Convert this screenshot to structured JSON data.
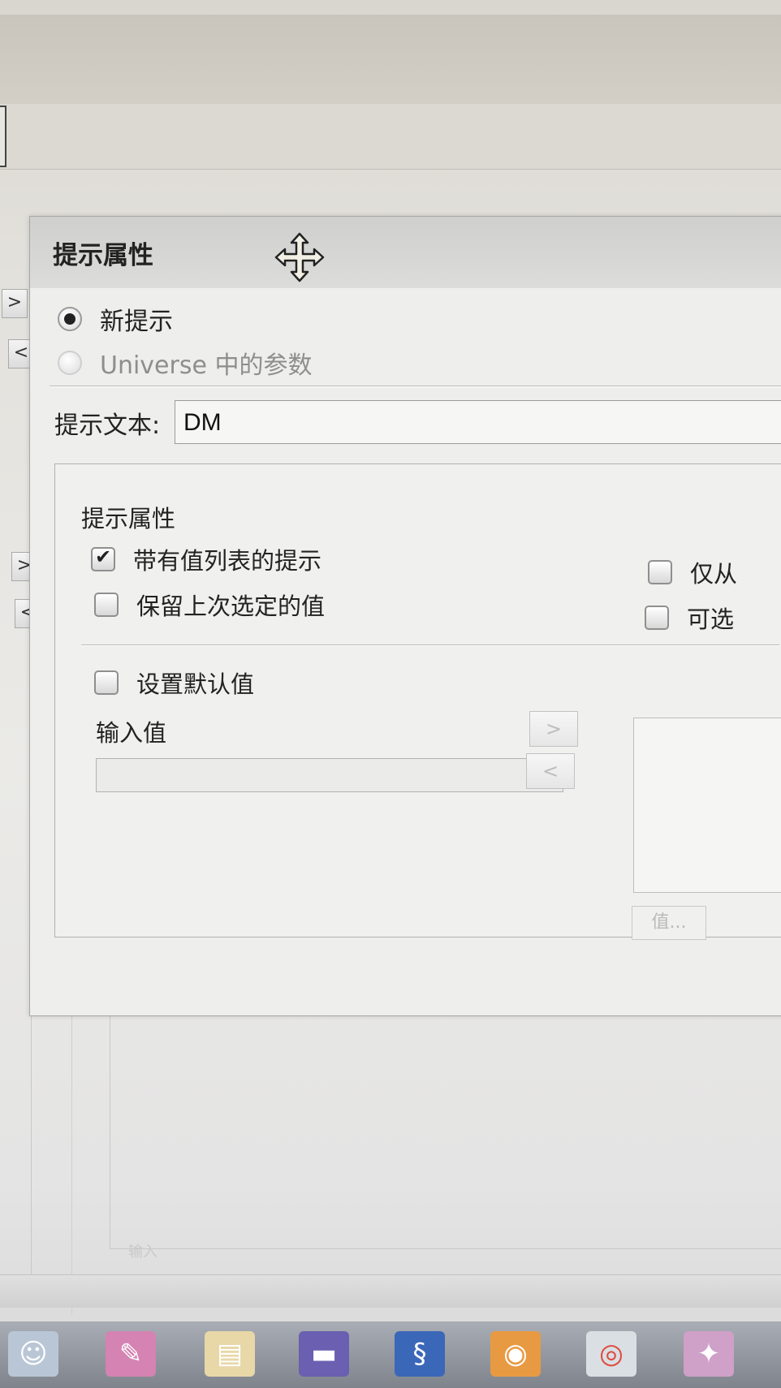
{
  "dialog": {
    "title": "提示属性",
    "radio_options": [
      {
        "label": "新提示",
        "selected": true,
        "enabled": true
      },
      {
        "label": "Universe 中的参数",
        "selected": false,
        "enabled": false
      }
    ],
    "prompt_text": {
      "label": "提示文本:",
      "value": "DM"
    },
    "properties": {
      "heading": "提示属性",
      "left_checkboxes": [
        {
          "label": "带有值列表的提示",
          "checked": true
        },
        {
          "label": "保留上次选定的值",
          "checked": false
        }
      ],
      "right_checkboxes": [
        {
          "label": "仅从",
          "checked": false
        },
        {
          "label": "可选",
          "checked": false
        }
      ],
      "default_value": {
        "label": "设置默认值",
        "checked": false
      },
      "input_value_label": "输入值",
      "add_arrow": ">",
      "remove_arrow": "<",
      "values_button": "值..."
    }
  },
  "background": {
    "side_arrows": [
      ">",
      "<",
      ">",
      "<"
    ],
    "hint_text": "输入"
  },
  "taskbar": {
    "icons": [
      "finder-icon",
      "app-icon-pink",
      "notes-icon",
      "app-icon-bar",
      "app-icon-blue-s",
      "firefox-icon",
      "chrome-icon",
      "app-icon-colorful"
    ]
  }
}
